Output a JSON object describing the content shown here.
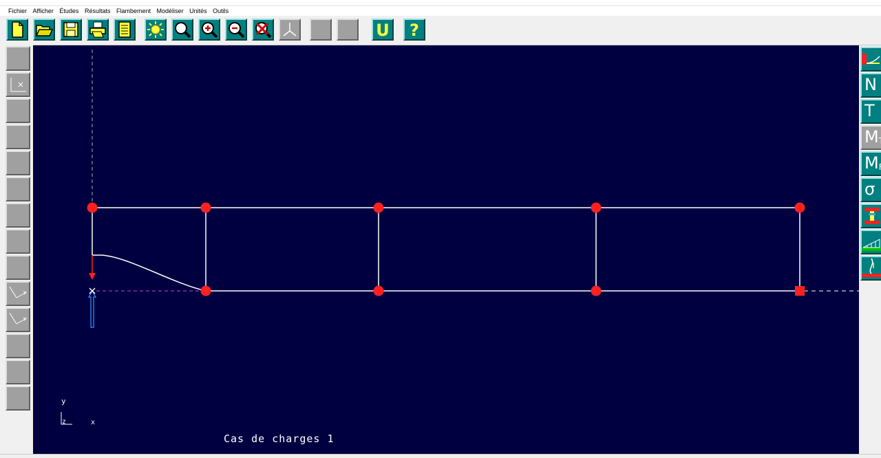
{
  "window": {
    "caption": ""
  },
  "menu": {
    "items": [
      "Fichier",
      "Afficher",
      "Études",
      "Résultats",
      "Flambement",
      "Modéliser",
      "Unités",
      "Outils"
    ]
  },
  "toolbar": {
    "buttons": [
      {
        "icon": "new-file-icon"
      },
      {
        "icon": "open-folder-icon"
      },
      {
        "icon": "save-disk-icon"
      },
      {
        "icon": "print-icon"
      },
      {
        "icon": "notes-icon"
      },
      {
        "icon": "sun-icon"
      },
      {
        "icon": "zoom-icon"
      },
      {
        "icon": "zoom-in-icon"
      },
      {
        "icon": "zoom-out-icon"
      },
      {
        "icon": "zoom-reset-icon"
      },
      {
        "icon": "axes-icon"
      },
      {
        "icon": "blank-icon"
      },
      {
        "icon": "blank-icon"
      },
      {
        "icon": "units-icon"
      },
      {
        "icon": "help-icon"
      }
    ],
    "help_label": "?",
    "units_label": "U"
  },
  "left_tools": {
    "count": 14
  },
  "right_tools": {
    "buttons": [
      {
        "icon": "deformed-shape-icon",
        "label": ""
      },
      {
        "icon": "normal-force-icon",
        "label": "N"
      },
      {
        "icon": "shear-force-icon",
        "label": "T"
      },
      {
        "icon": "torsion-moment-icon",
        "label": "M",
        "sub": "T"
      },
      {
        "icon": "bending-moment-icon",
        "label": "M",
        "sub": "F"
      },
      {
        "icon": "stress-icon",
        "label": "σ"
      },
      {
        "icon": "section-icon",
        "label": ""
      },
      {
        "icon": "distributed-load-icon",
        "label": ""
      },
      {
        "icon": "buckling-icon",
        "label": ""
      }
    ]
  },
  "canvas": {
    "case_label": "Cas de charges 1",
    "axis_y": "y",
    "axis_z": "z",
    "axis_x": "x",
    "colors": {
      "background": "#000040",
      "structure": "#ffffff",
      "nodes": "#ff2020",
      "load_arrow": "#ff2020",
      "reaction_arrow": "#3399ff",
      "guide": "#cc44cc"
    }
  }
}
